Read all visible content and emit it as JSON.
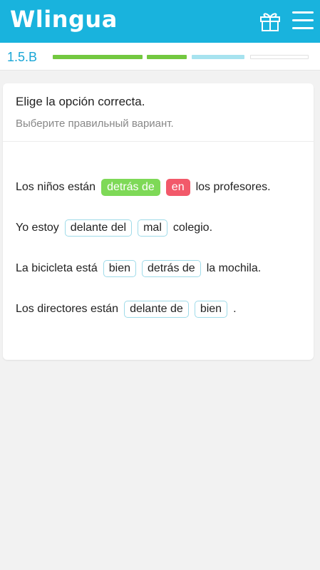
{
  "app": {
    "logo": "Wlingua"
  },
  "progress": {
    "lesson_code": "1.5.B",
    "segments": [
      "done",
      "done",
      "current",
      "todo"
    ]
  },
  "exercise": {
    "instruction_es": "Elige la opción correcta.",
    "instruction_ru": "Выберите правильный вариант.",
    "sentences": [
      {
        "before": "Los niños están",
        "options": [
          {
            "label": "detrás de",
            "state": "correct"
          },
          {
            "label": "en",
            "state": "wrong"
          }
        ],
        "after": "los profesores."
      },
      {
        "before": "Yo estoy",
        "options": [
          {
            "label": "delante del",
            "state": "neutral"
          },
          {
            "label": "mal",
            "state": "neutral"
          }
        ],
        "after": "colegio."
      },
      {
        "before": "La bicicleta está",
        "options": [
          {
            "label": "bien",
            "state": "neutral"
          },
          {
            "label": "detrás de",
            "state": "neutral"
          }
        ],
        "after": "la mochila."
      },
      {
        "before": "Los directores están",
        "options": [
          {
            "label": "delante de",
            "state": "neutral"
          },
          {
            "label": "bien",
            "state": "neutral"
          }
        ],
        "after": "."
      }
    ]
  },
  "colors": {
    "header": "#19b3dd",
    "correct": "#7ed957",
    "wrong": "#f2596a",
    "progress_done": "#73c840",
    "progress_current": "#a7e3ef"
  },
  "icons": {
    "gift": "gift-icon",
    "menu": "hamburger-menu-icon"
  }
}
